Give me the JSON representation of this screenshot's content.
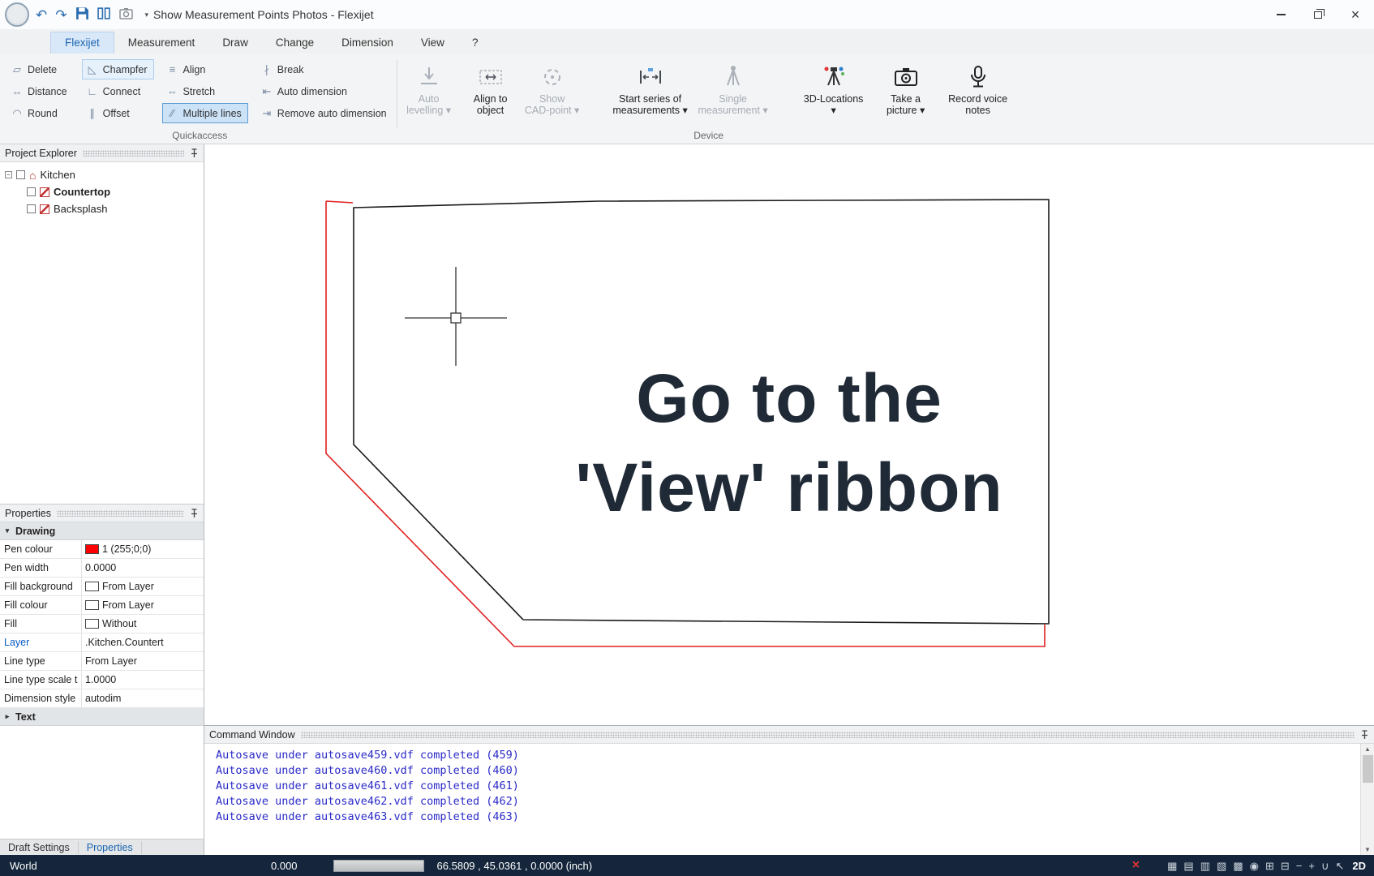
{
  "titlebar": {
    "title": "Show Measurement Points Photos -  Flexijet"
  },
  "tabs": {
    "items": [
      "Flexijet",
      "Measurement",
      "Draw",
      "Change",
      "Dimension",
      "View",
      "?"
    ]
  },
  "ribbon": {
    "groups": {
      "quickaccess": "Quickaccess",
      "device": "Device"
    },
    "small": [
      {
        "label": "Delete"
      },
      {
        "label": "Distance"
      },
      {
        "label": "Round"
      },
      {
        "label": "Champfer"
      },
      {
        "label": "Connect"
      },
      {
        "label": "Offset"
      },
      {
        "label": "Align"
      },
      {
        "label": "Stretch"
      },
      {
        "label": "Multiple lines"
      },
      {
        "label": "Break"
      },
      {
        "label": "Auto dimension"
      },
      {
        "label": "Remove auto dimension"
      }
    ],
    "big": [
      {
        "l1": "Auto",
        "l2": "levelling ▾"
      },
      {
        "l1": "Align to",
        "l2": "object"
      },
      {
        "l1": "Show",
        "l2": "CAD-point ▾"
      },
      {
        "l1": "Start series of",
        "l2": "measurements ▾"
      },
      {
        "l1": "Single",
        "l2": "measurement ▾"
      },
      {
        "l1": "3D-Locations",
        "l2": "▾"
      },
      {
        "l1": "Take a",
        "l2": "picture ▾"
      },
      {
        "l1": "Record voice",
        "l2": "notes"
      }
    ]
  },
  "project_explorer": {
    "title": "Project Explorer",
    "items": [
      {
        "label": "Kitchen"
      },
      {
        "label": "Countertop"
      },
      {
        "label": "Backsplash"
      }
    ]
  },
  "properties_panel": {
    "title": "Properties",
    "section_drawing": "Drawing",
    "section_text": "Text",
    "rows": [
      {
        "label": "Pen colour",
        "value": "1 (255;0;0)"
      },
      {
        "label": "Pen width",
        "value": "0.0000"
      },
      {
        "label": "Fill background",
        "value": "From Layer"
      },
      {
        "label": "Fill colour",
        "value": "From Layer"
      },
      {
        "label": "Fill",
        "value": "Without"
      },
      {
        "label": "Layer",
        "value": ".Kitchen.Countert"
      },
      {
        "label": "Line type",
        "value": "From Layer"
      },
      {
        "label": "Line type scale t",
        "value": "1.0000"
      },
      {
        "label": "Dimension style",
        "value": "autodim"
      }
    ],
    "bottom_tabs": [
      {
        "label": "Draft Settings"
      },
      {
        "label": "Properties"
      }
    ]
  },
  "canvas": {
    "overlay": {
      "line1": "Go to the",
      "line2": "'View' ribbon"
    }
  },
  "command_window": {
    "title": "Command Window",
    "lines": [
      "Autosave under autosave459.vdf completed (459)",
      "Autosave under autosave460.vdf completed (460)",
      "Autosave under autosave461.vdf completed (461)",
      "Autosave under autosave462.vdf completed (462)",
      "Autosave under autosave463.vdf completed (463)"
    ]
  },
  "statusbar": {
    "world": "World",
    "value": "0.000",
    "coords": "66.5809 , 45.0361 , 0.0000 (inch)",
    "mode": "2D",
    "icons": [
      {
        "name": "cancel-icon",
        "glyph": "×"
      },
      {
        "name": "view-top-icon",
        "glyph": "▦"
      },
      {
        "name": "view-front-icon",
        "glyph": "▤"
      },
      {
        "name": "view-side-icon",
        "glyph": "▥"
      },
      {
        "name": "view-iso-icon",
        "glyph": "▧"
      },
      {
        "name": "view-cube-icon",
        "glyph": "▩"
      },
      {
        "name": "orbit-icon",
        "glyph": "◉"
      },
      {
        "name": "grid-icon",
        "glyph": "⊞"
      },
      {
        "name": "snap-icon",
        "glyph": "⊟"
      },
      {
        "name": "zoom-out-icon",
        "glyph": "−"
      },
      {
        "name": "zoom-in-icon",
        "glyph": "+"
      },
      {
        "name": "magnet-icon",
        "glyph": "∪"
      },
      {
        "name": "pointer-icon",
        "glyph": "↖"
      }
    ]
  },
  "colors": {
    "accent": "#1c66b0",
    "pen_colour": "#ff0000",
    "command_text": "#2a2ac8",
    "statusbar_bg": "#15263c",
    "overlay_text": "#202a36",
    "drawing_line": "#1a1a1a",
    "offset_line": "#e02020"
  }
}
